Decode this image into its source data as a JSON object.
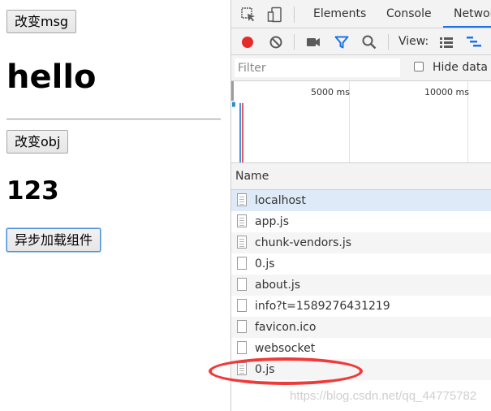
{
  "app": {
    "change_msg_label": "改变msg",
    "heading": "hello",
    "change_obj_label": "改变obj",
    "value": "123",
    "async_load_label": "异步加载组件"
  },
  "devtools": {
    "tabs": [
      "Elements",
      "Console",
      "Networ"
    ],
    "active_tab": "Networ",
    "toolbar": {
      "view_label": "View:",
      "icons": [
        "record-icon",
        "clear-icon",
        "screenshot-icon",
        "filter-icon",
        "search-icon",
        "list-view-icon",
        "waterfall-view-icon"
      ]
    },
    "filter": {
      "placeholder": "Filter",
      "hide_data_label": "Hide data U"
    },
    "overview": {
      "tick_labels": [
        "5000 ms",
        "10000 ms"
      ]
    },
    "table": {
      "column_header": "Name",
      "rows": [
        {
          "name": "localhost",
          "icon": "document-icon"
        },
        {
          "name": "app.js",
          "icon": "script-icon"
        },
        {
          "name": "chunk-vendors.js",
          "icon": "script-icon"
        },
        {
          "name": "0.js",
          "icon": "blank-file-icon"
        },
        {
          "name": "about.js",
          "icon": "blank-file-icon"
        },
        {
          "name": "info?t=1589276431219",
          "icon": "blank-file-icon"
        },
        {
          "name": "favicon.ico",
          "icon": "blank-file-icon"
        },
        {
          "name": "websocket",
          "icon": "blank-file-icon"
        },
        {
          "name": "0.js",
          "icon": "script-icon"
        }
      ]
    }
  },
  "watermark": "https://blog.csdn.net/qq_44775782",
  "colors": {
    "accent": "#1a73e8",
    "record": "#e52a2a",
    "annotation": "#f03a3a",
    "selected_row": "#dfeaf8"
  }
}
